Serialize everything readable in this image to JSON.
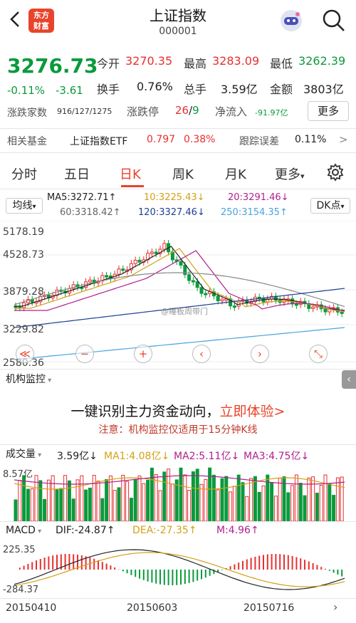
{
  "header": {
    "title": "上证指数",
    "code": "000001",
    "logo_line1": "东方",
    "logo_line2": "财富"
  },
  "quote": {
    "price": "3276.73",
    "change_pct": "-0.11%",
    "change_abs": "-3.61",
    "open_label": "今开",
    "open": "3270.35",
    "high_label": "最高",
    "high": "3283.09",
    "low_label": "最低",
    "low": "3262.39",
    "turnover_label": "换手",
    "turnover": "0.76%",
    "volume_label": "总手",
    "volume": "3.59亿",
    "amount_label": "金额",
    "amount": "3803亿",
    "breadth_label": "涨跌家数",
    "breadth": "916/127/1275",
    "limit_label": "涨跌停",
    "limit_up": "26",
    "limit_sep": "/",
    "limit_down": "9",
    "inflow_label": "净流入",
    "inflow": "-91.97亿",
    "more": "更多"
  },
  "fund": {
    "label": "相关基金",
    "name": "上证指数ETF",
    "price": "0.797",
    "pct": "0.38%",
    "err_label": "跟踪误差",
    "err": "0.11%",
    "err_arrow": ">"
  },
  "tabs": [
    "分时",
    "五日",
    "日K",
    "周K",
    "月K",
    "更多"
  ],
  "ma": {
    "label": "均线",
    "ma5": "MA5:3272.71↑",
    "ma10": "10:3225.43↓",
    "ma20": "20:3291.46↓",
    "ma60": "60:3318.42↑",
    "ma120": "120:3327.46↓",
    "ma250": "250:3154.35↑",
    "dk": "DK点"
  },
  "axis": {
    "p1": "5178.19",
    "p2": "4528.73",
    "p3": "3879.28",
    "p4": "3229.82",
    "p5": "2580.36"
  },
  "controls": [
    "≪",
    "−",
    "+",
    "‹",
    "›",
    "⤡"
  ],
  "watermark": "@睡板周带门",
  "monitor": {
    "label": "机构监控",
    "ad_text": "一键识别主力资金动向，",
    "ad_link": "立即体验>",
    "note": "注意：机构监控仅适用于15分钟K线"
  },
  "volume": {
    "label": "成交量",
    "value": "3.59亿↓",
    "ma1": "MA1:4.08亿↓",
    "ma2": "MA2:5.11亿↓",
    "ma3": "MA3:4.75亿↓",
    "top": "8.57亿"
  },
  "macd": {
    "label": "MACD",
    "dif": "DIF:-24.87↑",
    "dea": "DEA:-27.35↑",
    "m": "M:4.96↑",
    "top": "225.35",
    "bottom": "-284.37"
  },
  "dates": [
    "20150410",
    "20150603",
    "20150716"
  ],
  "colors": {
    "up": "#e83030",
    "down": "#0a9a3c",
    "ma5": "#222222",
    "ma10": "#d4a017",
    "ma20": "#b0208e",
    "ma60": "#888888",
    "ma120": "#1c3f94",
    "ma250": "#4aa3df"
  },
  "chart_data": {
    "type": "candlestick",
    "ylim": [
      2580.36,
      5178.19
    ],
    "ma": {
      "MA5": 3272.71,
      "MA10": 3225.43,
      "MA20": 3291.46,
      "MA60": 3318.42,
      "MA120": 3327.46,
      "MA250": 3154.35
    },
    "volume_top": "8.57亿",
    "macd_range": [
      -284.37,
      225.35
    ]
  }
}
